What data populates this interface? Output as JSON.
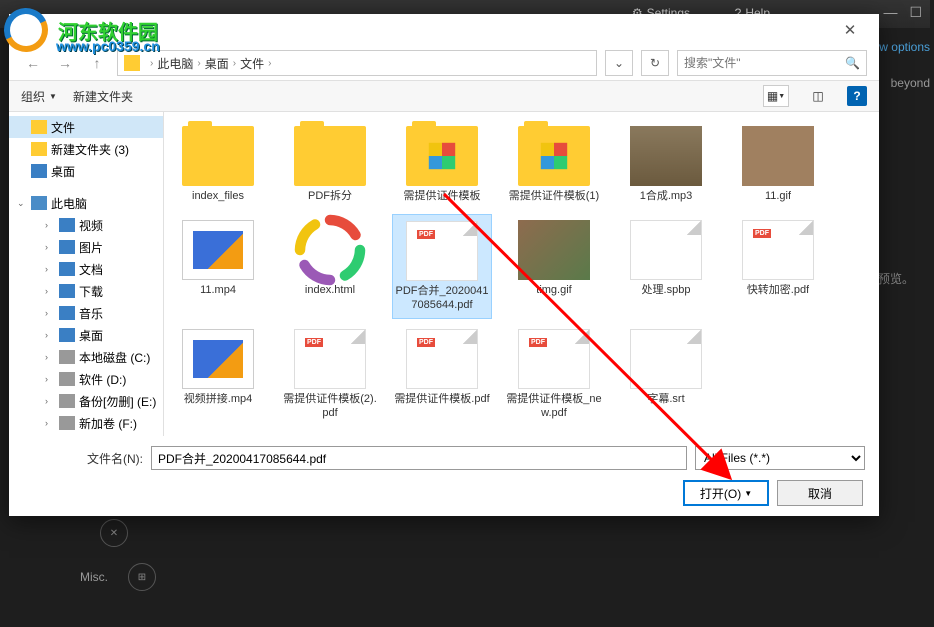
{
  "app": {
    "settings_label": "Settings",
    "help_label": "Help",
    "options_link": "w options",
    "beyond_text": "beyond",
    "no_preview": "没有预览。",
    "misc_label": "Misc."
  },
  "watermark": {
    "text1": "河东软件园",
    "text2": "www.pc0359.cn"
  },
  "dialog": {
    "breadcrumb": {
      "root": "此电脑",
      "p1": "桌面",
      "p2": "文件"
    },
    "search_placeholder": "搜索\"文件\"",
    "toolbar": {
      "organize": "组织",
      "new_folder": "新建文件夹"
    },
    "sidebar": {
      "items": [
        {
          "label": "文件",
          "icon": "folder",
          "sel": true,
          "indent": 1
        },
        {
          "label": "新建文件夹 (3)",
          "icon": "folder",
          "indent": 1
        },
        {
          "label": "桌面",
          "icon": "blue",
          "indent": 1
        }
      ],
      "pc_label": "此电脑",
      "pc_items": [
        {
          "label": "视频",
          "icon": "blue"
        },
        {
          "label": "图片",
          "icon": "blue"
        },
        {
          "label": "文档",
          "icon": "blue"
        },
        {
          "label": "下载",
          "icon": "blue"
        },
        {
          "label": "音乐",
          "icon": "blue"
        },
        {
          "label": "桌面",
          "icon": "blue"
        },
        {
          "label": "本地磁盘 (C:)",
          "icon": "disk"
        },
        {
          "label": "软件 (D:)",
          "icon": "disk"
        },
        {
          "label": "备份[勿删] (E:)",
          "icon": "disk"
        },
        {
          "label": "新加卷 (F:)",
          "icon": "disk"
        }
      ]
    },
    "files": [
      {
        "name": "index_files",
        "type": "folder"
      },
      {
        "name": "PDF拆分",
        "type": "folder"
      },
      {
        "name": "需提供证件模板",
        "type": "folder-multi"
      },
      {
        "name": "需提供证件模板(1)",
        "type": "folder-multi"
      },
      {
        "name": "1合成.mp3",
        "type": "mp3"
      },
      {
        "name": "11.gif",
        "type": "gif"
      },
      {
        "name": "11.mp4",
        "type": "video"
      },
      {
        "name": "index.html",
        "type": "html"
      },
      {
        "name": "PDF合并_20200417085644.pdf",
        "type": "pdf",
        "selected": true
      },
      {
        "name": "timg.gif",
        "type": "img"
      },
      {
        "name": "处理.spbp",
        "type": "page"
      },
      {
        "name": "快转加密.pdf",
        "type": "pdf"
      },
      {
        "name": "视频拼接.mp4",
        "type": "video"
      },
      {
        "name": "需提供证件模板(2).pdf",
        "type": "pdf"
      },
      {
        "name": "需提供证件模板.pdf",
        "type": "pdf"
      },
      {
        "name": "需提供证件模板_new.pdf",
        "type": "pdf"
      },
      {
        "name": "字幕.srt",
        "type": "page"
      }
    ],
    "footer": {
      "filename_label": "文件名(N):",
      "filename_value": "PDF合并_20200417085644.pdf",
      "filter_value": "All Files (*.*)",
      "open_btn": "打开(O)",
      "cancel_btn": "取消"
    }
  }
}
